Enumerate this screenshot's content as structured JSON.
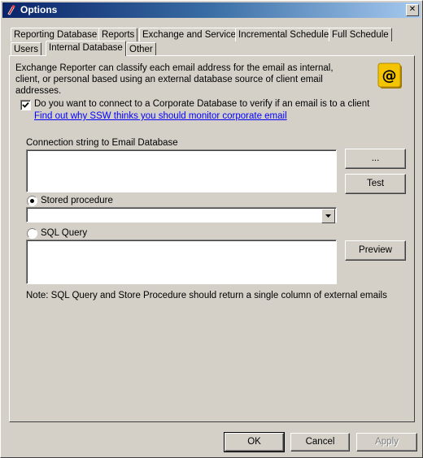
{
  "window": {
    "title": "Options",
    "close_label": "✕"
  },
  "tabs_row_back": [
    {
      "label": "Reporting Database"
    },
    {
      "label": "Reports"
    },
    {
      "label": "Exchange and Service"
    },
    {
      "label": "Incremental Schedule"
    },
    {
      "label": "Full Schedule"
    }
  ],
  "tabs_row_front": [
    {
      "label": "Users"
    },
    {
      "label": "Internal Database",
      "active": true
    },
    {
      "label": "Other"
    }
  ],
  "panel": {
    "description": "Exchange Reporter can classify each email address for the email as internal, client, or personal based using an external database source of client email addresses.",
    "connect_checkbox": {
      "label": "Do you want to connect to a Corporate Database to verify if an email is to a client",
      "checked": true
    },
    "link": "Find out why SSW thinks you should monitor corporate email",
    "connection_label": "Connection string to Email Database",
    "connection_value": "",
    "browse_button": "...",
    "test_button": "Test",
    "stored_procedure": {
      "label": "Stored procedure",
      "selected": true,
      "value": ""
    },
    "sql_query": {
      "label": "SQL Query",
      "selected": false,
      "value": ""
    },
    "preview_button": "Preview",
    "note": "Note: SQL Query and Store Procedure should return a single column of external emails"
  },
  "footer": {
    "ok": "OK",
    "cancel": "Cancel",
    "apply": "Apply"
  },
  "colors": {
    "title_start": "#0a246a",
    "title_end": "#a6caf0",
    "face": "#d4d0c8",
    "link": "#0000ff",
    "badge": "#f5c400"
  }
}
